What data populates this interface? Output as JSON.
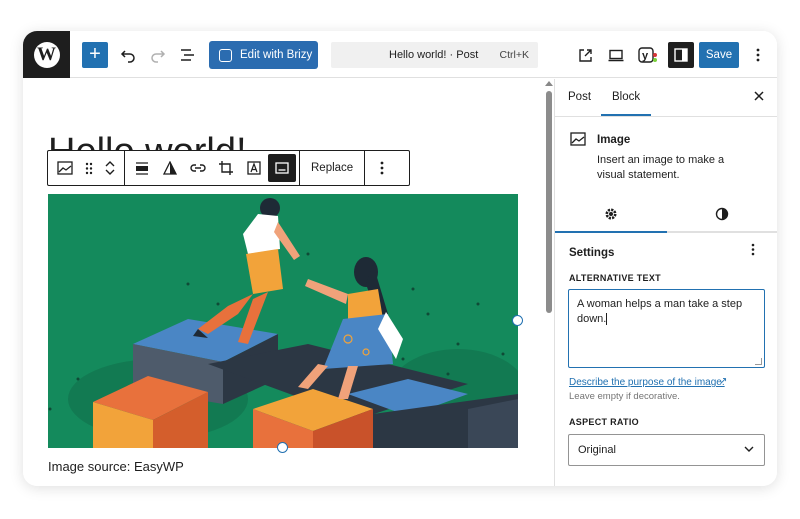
{
  "topbar": {
    "logo_label": "W",
    "add_label": "+",
    "brizy_label": "Edit with Brizy",
    "doc_title": "Hello world! · Post",
    "shortcut": "Ctrl+K",
    "save_label": "Save"
  },
  "editor": {
    "post_title": "Hello world!",
    "toolbar": {
      "replace_label": "Replace"
    },
    "caption": "Image source: EasyWP"
  },
  "sidebar": {
    "tabs": [
      {
        "label": "Post"
      },
      {
        "label": "Block"
      }
    ],
    "active_tab": "Block",
    "block": {
      "name": "Image",
      "description": "Insert an image to make a visual statement."
    },
    "settings": {
      "heading": "Settings",
      "alt_text_label": "ALTERNATIVE TEXT",
      "alt_text_value": "A woman helps a man take a step down.",
      "help_link": "Describe the purpose of the image.",
      "hint": "Leave empty if decorative.",
      "aspect_ratio_label": "ASPECT RATIO",
      "aspect_ratio_value": "Original"
    }
  },
  "colors": {
    "accent": "#2271b1",
    "image_bg": "#148a5c"
  }
}
